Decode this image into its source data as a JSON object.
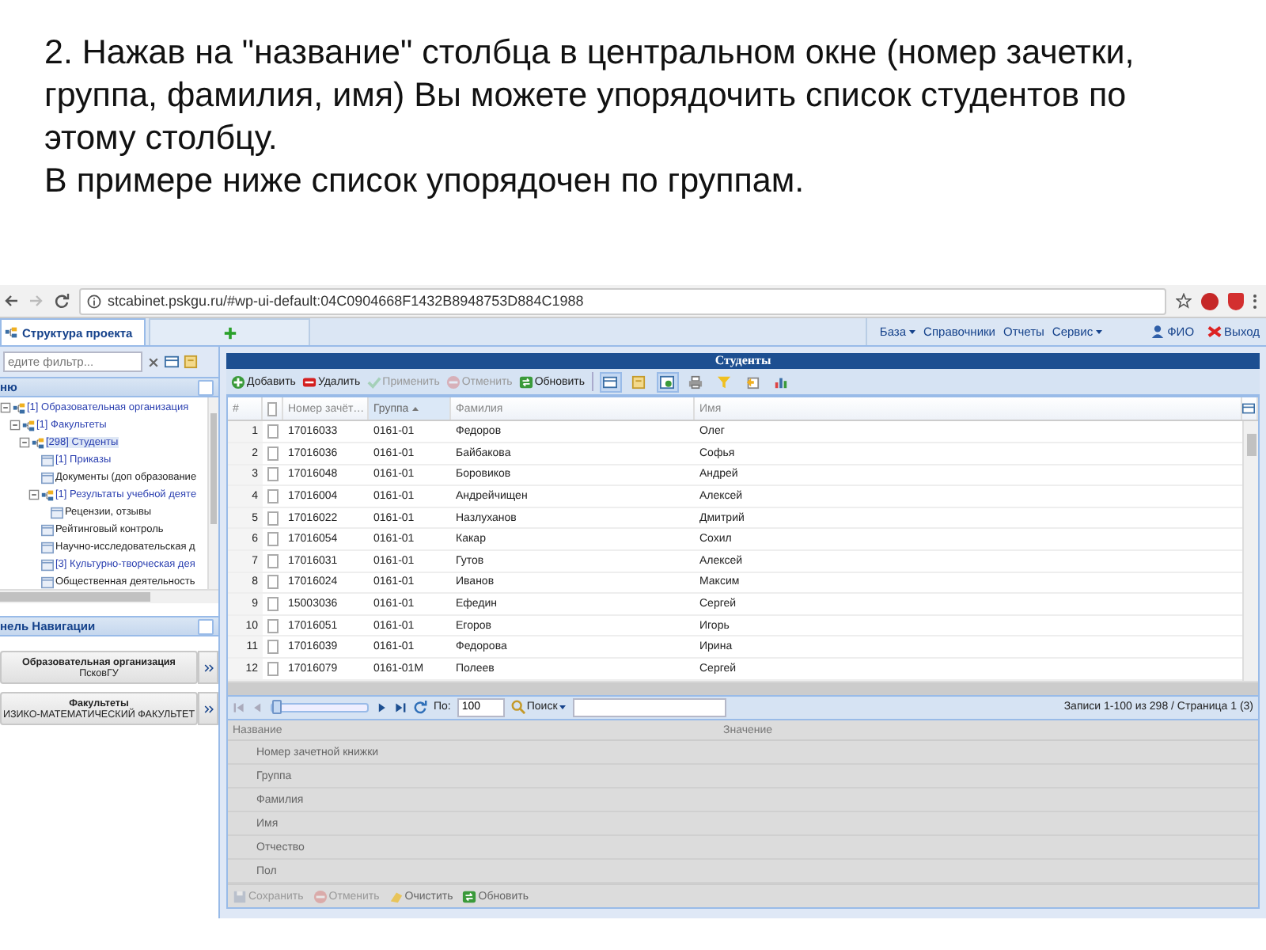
{
  "slide": {
    "paragraphs": [
      "2. Нажав на \"название\" столбца в центральном окне (номер зачетки, группа, фамилия, имя) Вы можете упорядочить список студентов по этому столбцу.",
      "В примере ниже список упорядочен по группам."
    ]
  },
  "browser": {
    "url": "stcabinet.pskgu.ru/#wp-ui-default:04C0904668F1432B8948753D884C1988"
  },
  "app_header": {
    "tabs": [
      {
        "label": "Структура проекта",
        "selected": true
      }
    ],
    "menu": [
      {
        "label": "База",
        "dropdown": true
      },
      {
        "label": "Справочники",
        "dropdown": false
      },
      {
        "label": "Отчеты",
        "dropdown": false
      },
      {
        "label": "Сервис",
        "dropdown": true
      }
    ],
    "user": "ФИО",
    "logout": "Выход"
  },
  "left_panel": {
    "filter_placeholder": "едите фильтр...",
    "menu_title": "ню",
    "tree": [
      {
        "label": "[1] Образовательная организация",
        "kind": "group",
        "linked": true,
        "selected": false,
        "expanded": true,
        "children": [
          {
            "label": "[1] Факультеты",
            "kind": "group",
            "linked": true,
            "selected": false,
            "expanded": true,
            "children": [
              {
                "label": "[298] Студенты",
                "kind": "group",
                "linked": true,
                "selected": true,
                "expanded": true,
                "children": [
                  {
                    "label": "[1] Приказы",
                    "kind": "doc",
                    "linked": true,
                    "selected": false
                  },
                  {
                    "label": "Документы (доп образование",
                    "kind": "doc",
                    "linked": false,
                    "selected": false
                  },
                  {
                    "label": "[1] Результаты учебной деяте",
                    "kind": "group",
                    "linked": true,
                    "selected": false,
                    "expanded": true,
                    "children": [
                      {
                        "label": "Рецензии, отзывы",
                        "kind": "doc",
                        "linked": false,
                        "selected": false
                      }
                    ]
                  },
                  {
                    "label": "Рейтинговый контроль",
                    "kind": "doc",
                    "linked": false,
                    "selected": false
                  },
                  {
                    "label": "Научно-исследовательская д",
                    "kind": "doc",
                    "linked": false,
                    "selected": false
                  },
                  {
                    "label": "[3] Культурно-творческая дея",
                    "kind": "doc",
                    "linked": true,
                    "selected": false
                  },
                  {
                    "label": "Общественная деятельность",
                    "kind": "doc",
                    "linked": false,
                    "selected": false
                  }
                ]
              }
            ]
          }
        ]
      }
    ],
    "nav_title": "нель Навигации",
    "nav_items": [
      {
        "title": "Образовательная организация",
        "value": "ПсковГУ"
      },
      {
        "title": "Факультеты",
        "value": "ИЗИКО-МАТЕМАТИЧЕСКИЙ ФАКУЛЬТЕТ"
      }
    ]
  },
  "main": {
    "title": "Студенты",
    "toolbar": [
      {
        "kind": "add",
        "label": "Добавить",
        "disabled": false
      },
      {
        "kind": "delete",
        "label": "Удалить",
        "disabled": false
      },
      {
        "kind": "apply",
        "label": "Применить",
        "disabled": true
      },
      {
        "kind": "cancel",
        "label": "Отменить",
        "disabled": true
      },
      {
        "kind": "refresh",
        "label": "Обновить",
        "disabled": false
      }
    ],
    "toolbar_icons": [
      {
        "kind": "grid",
        "pressed": true
      },
      {
        "kind": "form",
        "pressed": false
      },
      {
        "kind": "export",
        "pressed": true
      },
      {
        "kind": "print",
        "pressed": false
      },
      {
        "kind": "filter",
        "pressed": false
      },
      {
        "kind": "import",
        "pressed": false
      },
      {
        "kind": "chart",
        "pressed": false
      }
    ],
    "grid": {
      "header_checked": false,
      "columns": [
        {
          "label": "#",
          "sorted": false
        },
        {
          "label": "Номер зачёт…",
          "sorted": false
        },
        {
          "label": "Группа",
          "sorted": true
        },
        {
          "label": "Фамилия",
          "sorted": false
        },
        {
          "label": "Имя",
          "sorted": false
        }
      ],
      "rows": [
        {
          "checked": false,
          "cells": [
            "1",
            "17016033",
            "0161-01",
            "Федоров",
            "Олег"
          ]
        },
        {
          "checked": false,
          "cells": [
            "2",
            "17016036",
            "0161-01",
            "Байбакова",
            "Софья"
          ]
        },
        {
          "checked": false,
          "cells": [
            "3",
            "17016048",
            "0161-01",
            "Боровиков",
            "Андрей"
          ]
        },
        {
          "checked": false,
          "cells": [
            "4",
            "17016004",
            "0161-01",
            "Андрейчищен",
            "Алексей"
          ]
        },
        {
          "checked": false,
          "cells": [
            "5",
            "17016022",
            "0161-01",
            "Назлуханов",
            "Дмитрий"
          ]
        },
        {
          "checked": false,
          "cells": [
            "6",
            "17016054",
            "0161-01",
            "Какар",
            "Сохил"
          ]
        },
        {
          "checked": false,
          "cells": [
            "7",
            "17016031",
            "0161-01",
            "Гутов",
            "Алексей"
          ]
        },
        {
          "checked": false,
          "cells": [
            "8",
            "17016024",
            "0161-01",
            "Иванов",
            "Максим"
          ]
        },
        {
          "checked": false,
          "cells": [
            "9",
            "15003036",
            "0161-01",
            "Ефедин",
            "Сергей"
          ]
        },
        {
          "checked": false,
          "cells": [
            "10",
            "17016051",
            "0161-01",
            "Егоров",
            "Игорь"
          ]
        },
        {
          "checked": false,
          "cells": [
            "11",
            "17016039",
            "0161-01",
            "Федорова",
            "Ирина"
          ]
        },
        {
          "checked": false,
          "cells": [
            "12",
            "17016079",
            "0161-01М",
            "Полеев",
            "Сергей"
          ]
        }
      ]
    },
    "pager": {
      "level": 0,
      "page_size_label": "По:",
      "page_size": "100",
      "search_label": "Поиск",
      "info": "Записи 1-100 из 298 / Страница 1 (3)"
    },
    "properties": {
      "disabled": true,
      "columns": [
        "Название",
        "Значение"
      ],
      "rows": [
        "Номер зачетной книжки",
        "Группа",
        "Фамилия",
        "Имя",
        "Отчество",
        "Пол"
      ],
      "buttons": [
        {
          "kind": "save",
          "label": "Сохранить",
          "disabled": true
        },
        {
          "kind": "cancel",
          "label": "Отменить",
          "disabled": true
        },
        {
          "kind": "clear",
          "label": "Очистить",
          "disabled": false
        },
        {
          "kind": "refresh",
          "label": "Обновить",
          "disabled": false
        }
      ]
    }
  }
}
